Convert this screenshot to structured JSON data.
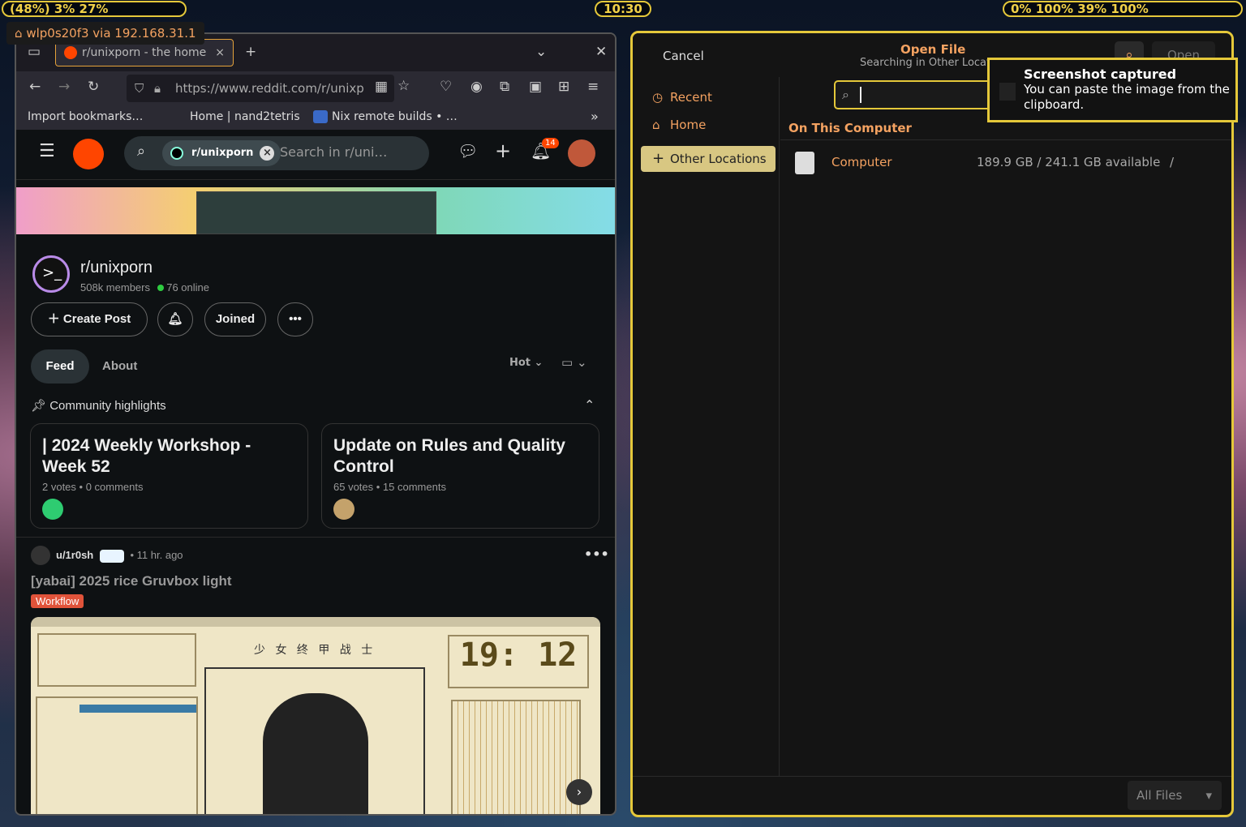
{
  "topbar": {
    "left": "(48%)  3%  27%",
    "clock": "10:30",
    "right": "0%  100%  39%  100%"
  },
  "network_popup": "wlp0s20f3 via 192.168.31.1",
  "browser": {
    "tab_title": "r/unixporn - the home",
    "url": "https://www.reddit.com/r/unixp",
    "bookmarks": [
      "Import bookmarks…",
      "Home | nand2tetris",
      "Nix remote builds • …"
    ]
  },
  "reddit": {
    "search_chip": "r/unixporn",
    "search_placeholder": "Search in r/uni…",
    "notif_count": "14",
    "sub_name": "r/unixporn",
    "members": "508k members",
    "online": "76 online",
    "create_post": "Create Post",
    "joined": "Joined",
    "tabs": [
      "Feed",
      "About"
    ],
    "sort": "Hot",
    "highlights_title": "Community highlights",
    "highlights": [
      {
        "title": "| 2024 Weekly Workshop - Week 52",
        "meta": "2 votes • 0 comments"
      },
      {
        "title": "Update on Rules and Quality Control",
        "meta": "65 votes • 15 comments"
      }
    ],
    "post": {
      "user": "u/1r0sh",
      "time": "• 11 hr. ago",
      "title": "[yabai] 2025 rice Gruvbox light",
      "flair": "Workflow",
      "preview_clock": "19: 12",
      "preview_heading": "少 女 终 甲 战 士"
    }
  },
  "dialog": {
    "cancel": "Cancel",
    "title": "Open File",
    "subtitle": "Searching in Other Locati",
    "open": "Open",
    "sidebar": [
      "Recent",
      "Home",
      "Other Locations"
    ],
    "section": "On This Computer",
    "location_name": "Computer",
    "location_space": "189.9 GB / 241.1 GB available",
    "location_path": "/",
    "filter": "All Files"
  },
  "toast": {
    "title": "Screenshot captured",
    "body": "You can paste the image from the clipboard."
  }
}
